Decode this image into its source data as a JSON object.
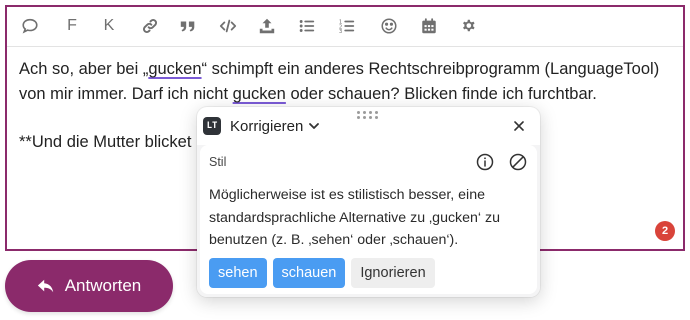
{
  "toolbar": {
    "items": [
      {
        "name": "emoji-quote-icon"
      },
      {
        "label": "F"
      },
      {
        "label": "K"
      }
    ]
  },
  "editor": {
    "para1_prefix": "Ach so, aber bei „",
    "para1_mark1": "gucken",
    "para1_mid": "“ schimpft ein anderes Rechtschreibprogramm (LanguageTool) von mir immer. Darf ich nicht ",
    "para1_mark2": "gucken",
    "para1_suffix": " oder schauen? Blicken finde ich furchtbar.",
    "para2": "**Und die Mutter blicket",
    "error_count": "2",
    "accent_color": "#8b2a6b"
  },
  "reply_button": {
    "label": "Antworten"
  },
  "popup": {
    "logo_text": "LT",
    "title": "Korrigieren",
    "category": "Stil",
    "message": "Möglicherweise ist es stilistisch besser, eine standardsprachliche Alternative zu ‚gucken‘ zu benutzen (z. B. ‚sehen‘ oder ‚schauen‘).",
    "suggestions": [
      "sehen",
      "schauen"
    ],
    "ignore_label": "Ignorieren",
    "suggestion_color": "#4a9cf2"
  }
}
